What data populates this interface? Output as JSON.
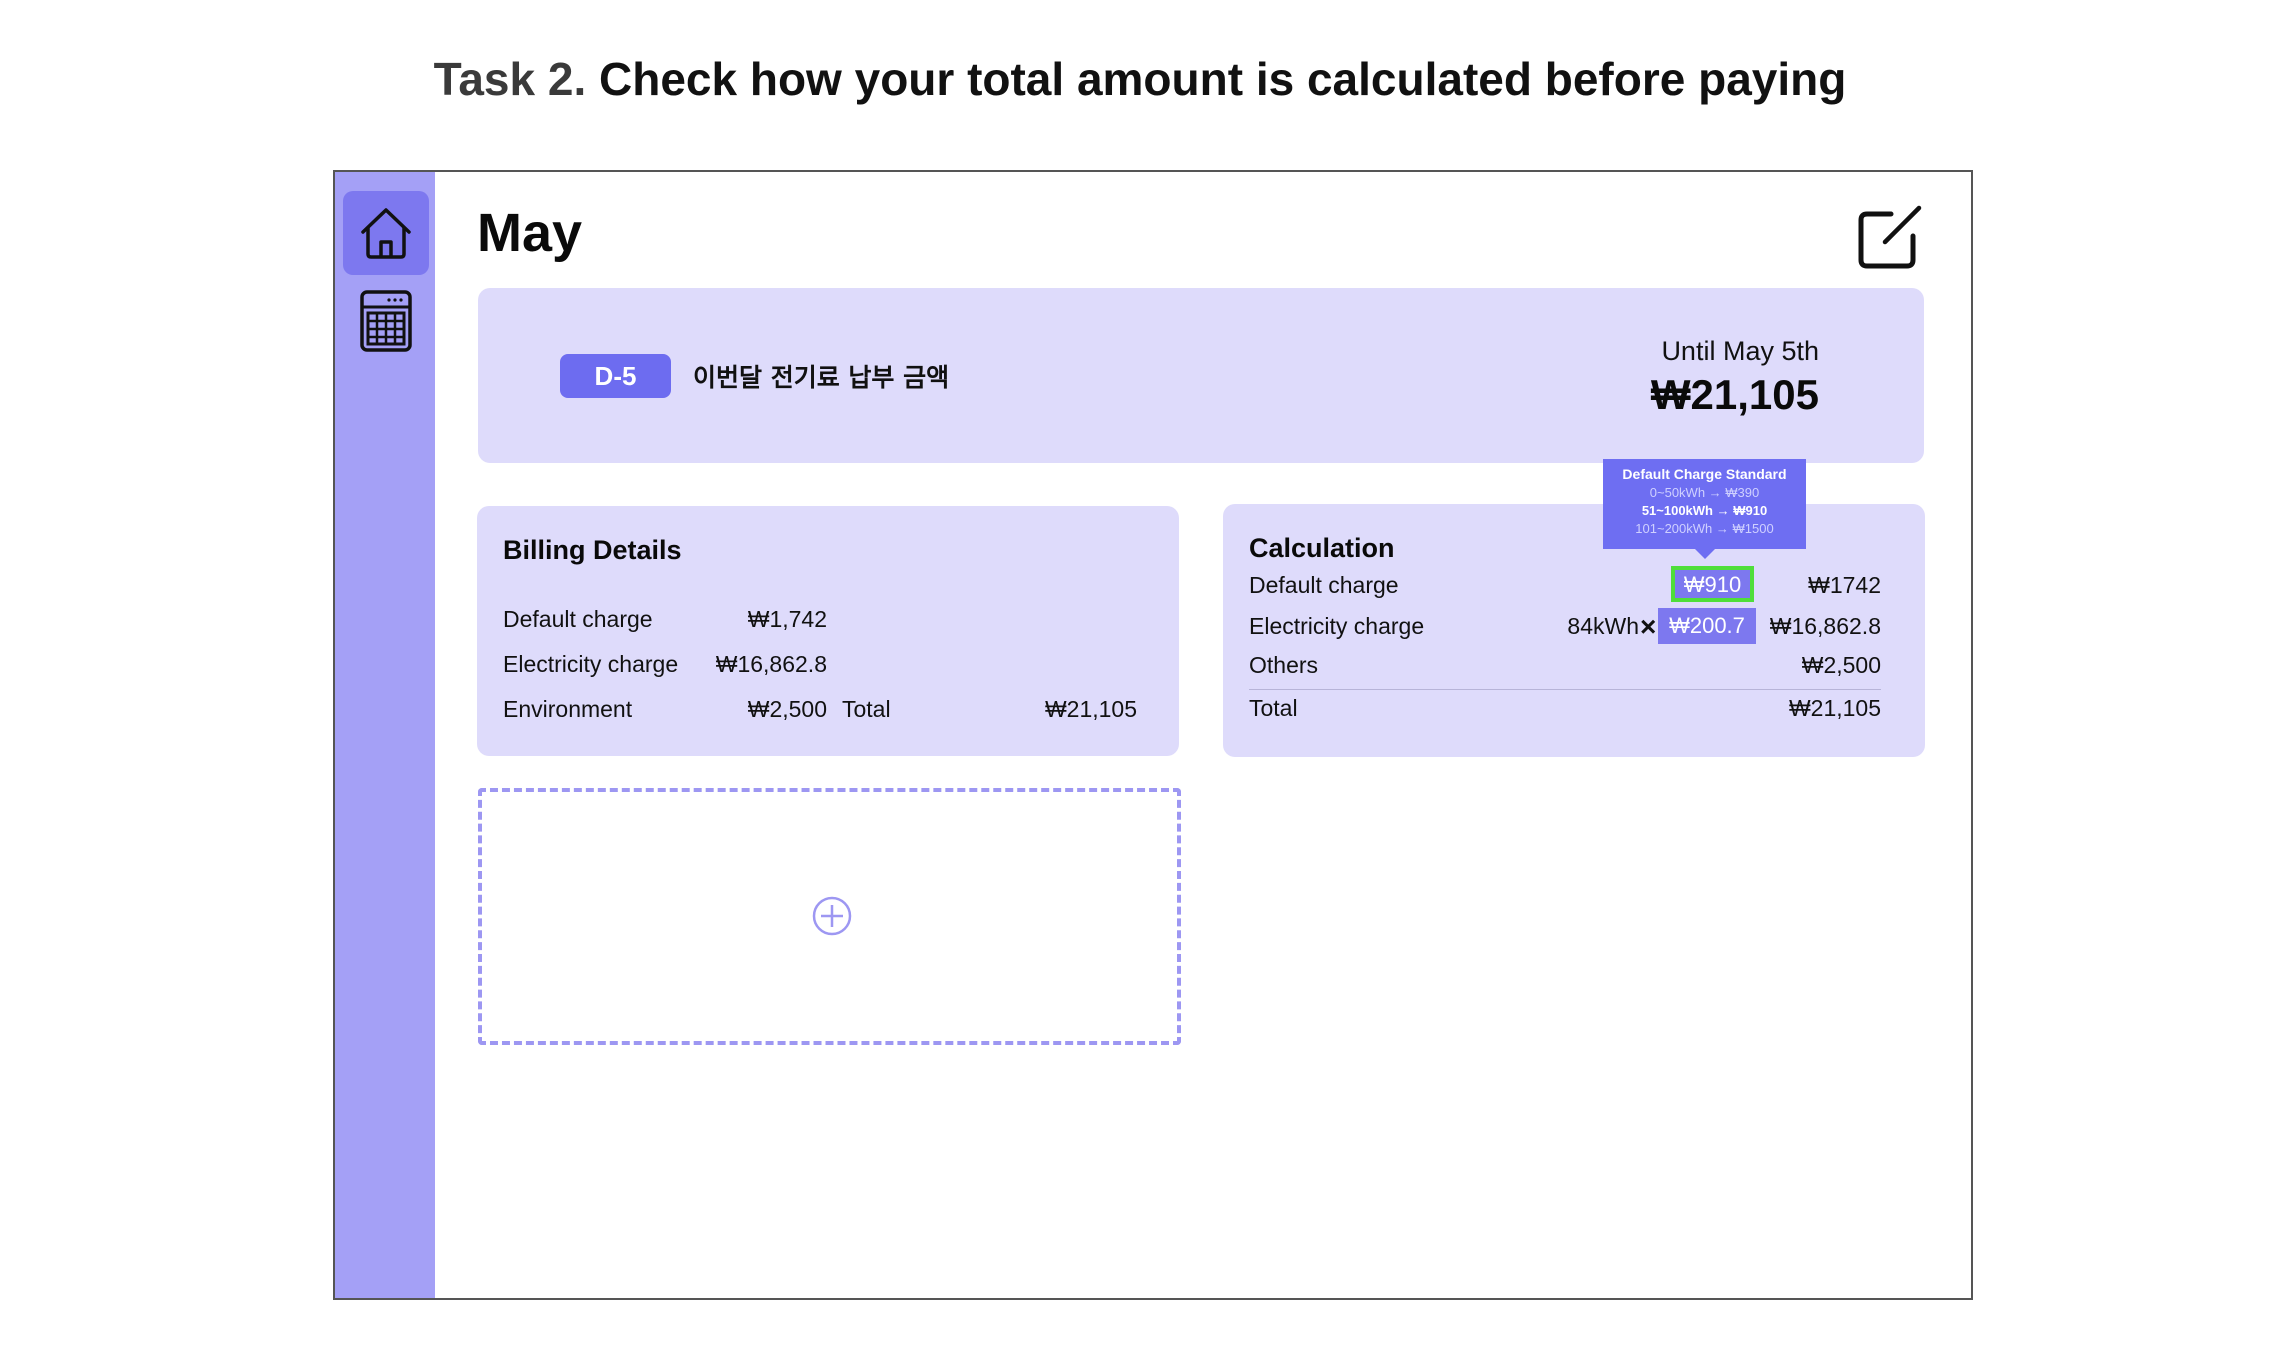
{
  "task": {
    "prefix": "Task 2.",
    "text": "Check how your total amount is calculated before paying"
  },
  "sidebar": {
    "items": [
      {
        "icon": "home-icon",
        "active": true
      },
      {
        "icon": "calculator-icon",
        "active": false
      }
    ]
  },
  "header": {
    "title": "May",
    "action_icon": "edit-icon"
  },
  "banner": {
    "badge": "D-5",
    "label": "이번달 전기료 납부 금액",
    "due": "Until May 5th",
    "amount": "₩21,105"
  },
  "billing": {
    "title": "Billing Details",
    "rows": [
      {
        "label": "Default charge",
        "value": "₩1,742"
      },
      {
        "label": "Electricity charge",
        "value": "₩16,862.8"
      },
      {
        "label": "Environment",
        "value": "₩2,500"
      }
    ],
    "total_label": "Total",
    "total_value": "₩21,105"
  },
  "calculation": {
    "title": "Calculation",
    "default": {
      "label": "Default charge",
      "rate": "₩910",
      "value": "₩1742"
    },
    "electricity": {
      "label": "Electricity charge",
      "usage": "84kWh",
      "times": "×",
      "rate": "₩200.7",
      "value": "₩16,862.8"
    },
    "others": {
      "label": "Others",
      "value": "₩2,500"
    },
    "total": {
      "label": "Total",
      "value": "₩21,105"
    }
  },
  "tooltip": {
    "title": "Default Charge Standard",
    "lines": [
      "0~50kWh → ₩390",
      "51~100kWh → ₩910",
      "101~200kWh → ₩1500"
    ],
    "active_index": 1
  },
  "add_widget": {
    "icon": "plus-circle-icon"
  },
  "colors": {
    "sidebar": "#a4a0f6",
    "accent": "#6d6cf0",
    "card": "#dedbfb",
    "highlight": "#4fde3a"
  }
}
